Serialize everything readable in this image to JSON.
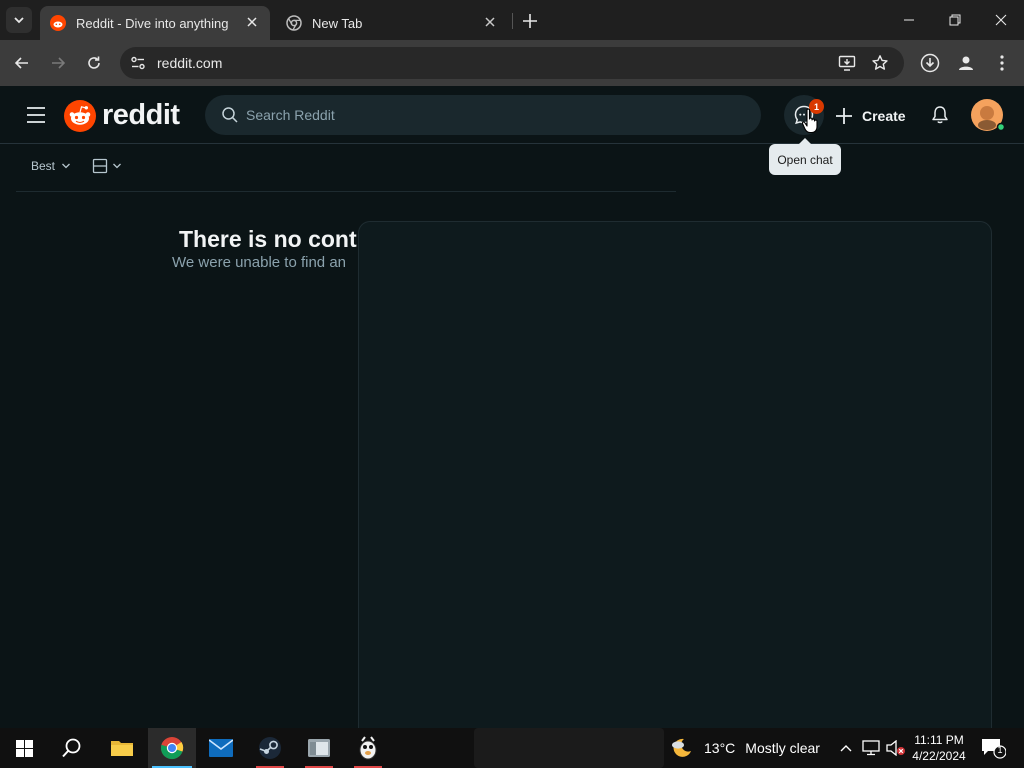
{
  "browser": {
    "tabs": [
      {
        "title": "Reddit - Dive into anything",
        "active": true
      },
      {
        "title": "New Tab",
        "active": false
      }
    ],
    "url": "reddit.com"
  },
  "reddit": {
    "brand": "reddit",
    "search_placeholder": "Search Reddit",
    "chat_badge": "1",
    "create_label": "Create",
    "tooltip": "Open chat",
    "sort_label": "Best",
    "empty_title": "There is no cont",
    "empty_subtitle": "We were unable to find an"
  },
  "taskbar": {
    "weather_temp": "13°C",
    "weather_condition": "Mostly clear",
    "time": "11:11 PM",
    "date": "4/22/2024",
    "notification_count": "1"
  },
  "colors": {
    "reddit_orange": "#ff4500",
    "badge": "#d93900",
    "background": "#0b1416"
  }
}
